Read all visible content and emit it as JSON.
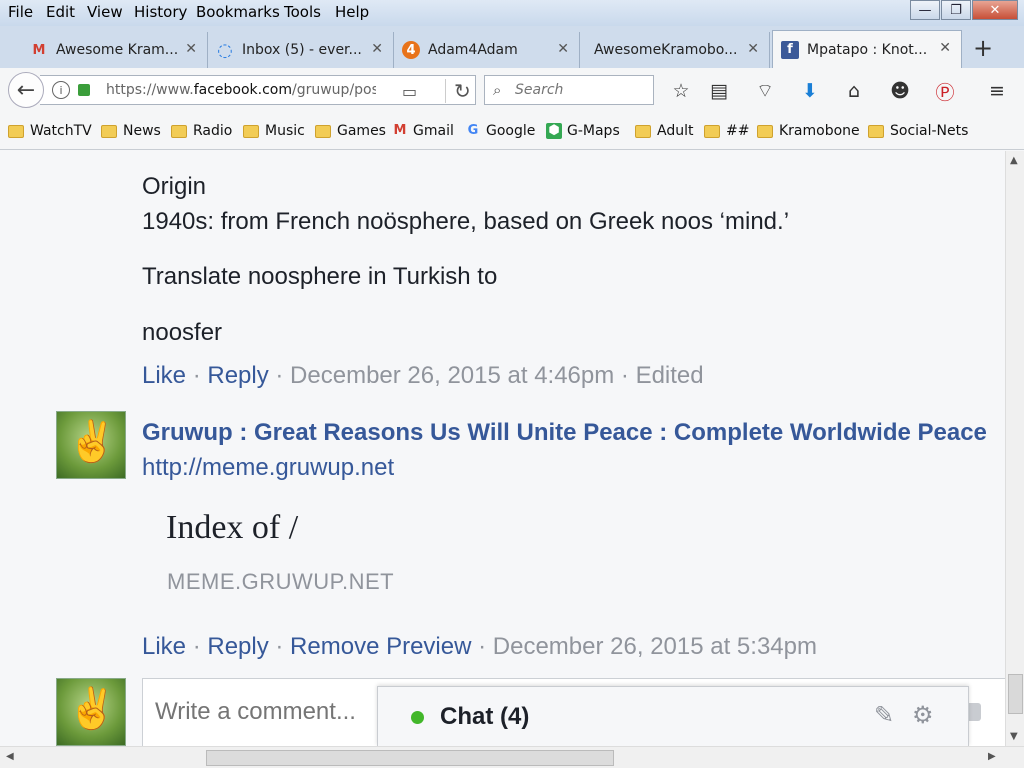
{
  "menu": [
    "File",
    "Edit",
    "View",
    "History",
    "Bookmarks",
    "Tools",
    "Help"
  ],
  "window_buttons": {
    "minimize": "—",
    "maximize": "❐",
    "close": "✕"
  },
  "tabs": [
    {
      "label": "Awesome Kram...",
      "icon": "gmail-icon",
      "glyph": "M",
      "color": "#d23f31"
    },
    {
      "label": "Inbox (5) - ever...",
      "icon": "loading-icon",
      "glyph": "◌",
      "color": "#2a7de1"
    },
    {
      "label": "Adam4Adam",
      "icon": "adam4adam-icon",
      "glyph": "4",
      "color": "#e8731a"
    },
    {
      "label": "AwesomeKramobo...",
      "icon": "",
      "glyph": "",
      "color": "#000"
    },
    {
      "label": "Mpatapo : Knot...",
      "icon": "facebook-icon",
      "glyph": "f",
      "color": "#3b5998"
    }
  ],
  "nav": {
    "url_prefix": "https://www.",
    "url_domain": "facebook.com",
    "url_rest": "/gruwup/pos",
    "search_placeholder": "Search"
  },
  "bookmarks": [
    {
      "label": "WatchTV",
      "type": "folder"
    },
    {
      "label": "News",
      "type": "folder"
    },
    {
      "label": "Radio",
      "type": "folder"
    },
    {
      "label": "Music",
      "type": "folder"
    },
    {
      "label": "Games",
      "type": "folder"
    },
    {
      "label": "Gmail",
      "type": "gmail"
    },
    {
      "label": "Google",
      "type": "google"
    },
    {
      "label": "G-Maps",
      "type": "maps"
    },
    {
      "label": "Adult",
      "type": "folder"
    },
    {
      "label": "##",
      "type": "folder"
    },
    {
      "label": "Kramobone",
      "type": "folder"
    },
    {
      "label": "Social-Nets",
      "type": "folder"
    }
  ],
  "post": {
    "origin_label": "Origin",
    "origin_text": "1940s: from French noösphere, based on Greek noos ‘mind.’",
    "translate_text": "Translate noosphere in Turkish to",
    "translation": "noosfer",
    "meta1": {
      "like": "Like",
      "sep": " · ",
      "reply": "Reply",
      "date": "December 26, 2015 at 4:46pm",
      "edited": "Edited"
    },
    "reply": {
      "author": "Gruwup : Great Reasons Us Will Unite Peace : Complete Worldwide Peace",
      "link": "http://meme.gruwup.net",
      "preview_title": "Index of /",
      "preview_domain": "MEME.GRUWUP.NET"
    },
    "meta2": {
      "like": "Like",
      "sep": " · ",
      "reply": "Reply",
      "remove": "Remove Preview",
      "date": "December 26, 2015 at 5:34pm"
    },
    "comment_placeholder": "Write a comment..."
  },
  "chat": {
    "label": "Chat (4)",
    "status_color": "#42b72a"
  }
}
